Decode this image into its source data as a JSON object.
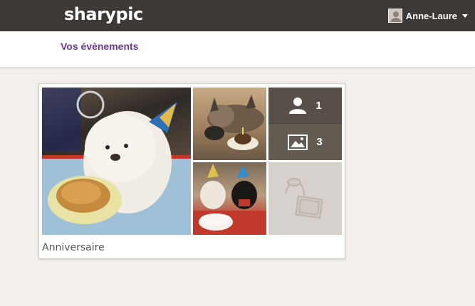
{
  "header": {
    "logo": "sharypic",
    "user_name": "Anne-Laure"
  },
  "subheader": {
    "events_link": "Vos évènements"
  },
  "event": {
    "title": "Anniversaire",
    "participants_count": "1",
    "photos_count": "3",
    "photos": [
      {
        "name": "dog-birthday-photo"
      },
      {
        "name": "cat-birthday-photo"
      },
      {
        "name": "dogs-cake-photo"
      }
    ]
  },
  "colors": {
    "topbar": "#3d3935",
    "accent": "#6b3a8a",
    "stats_bg": "#585048"
  }
}
